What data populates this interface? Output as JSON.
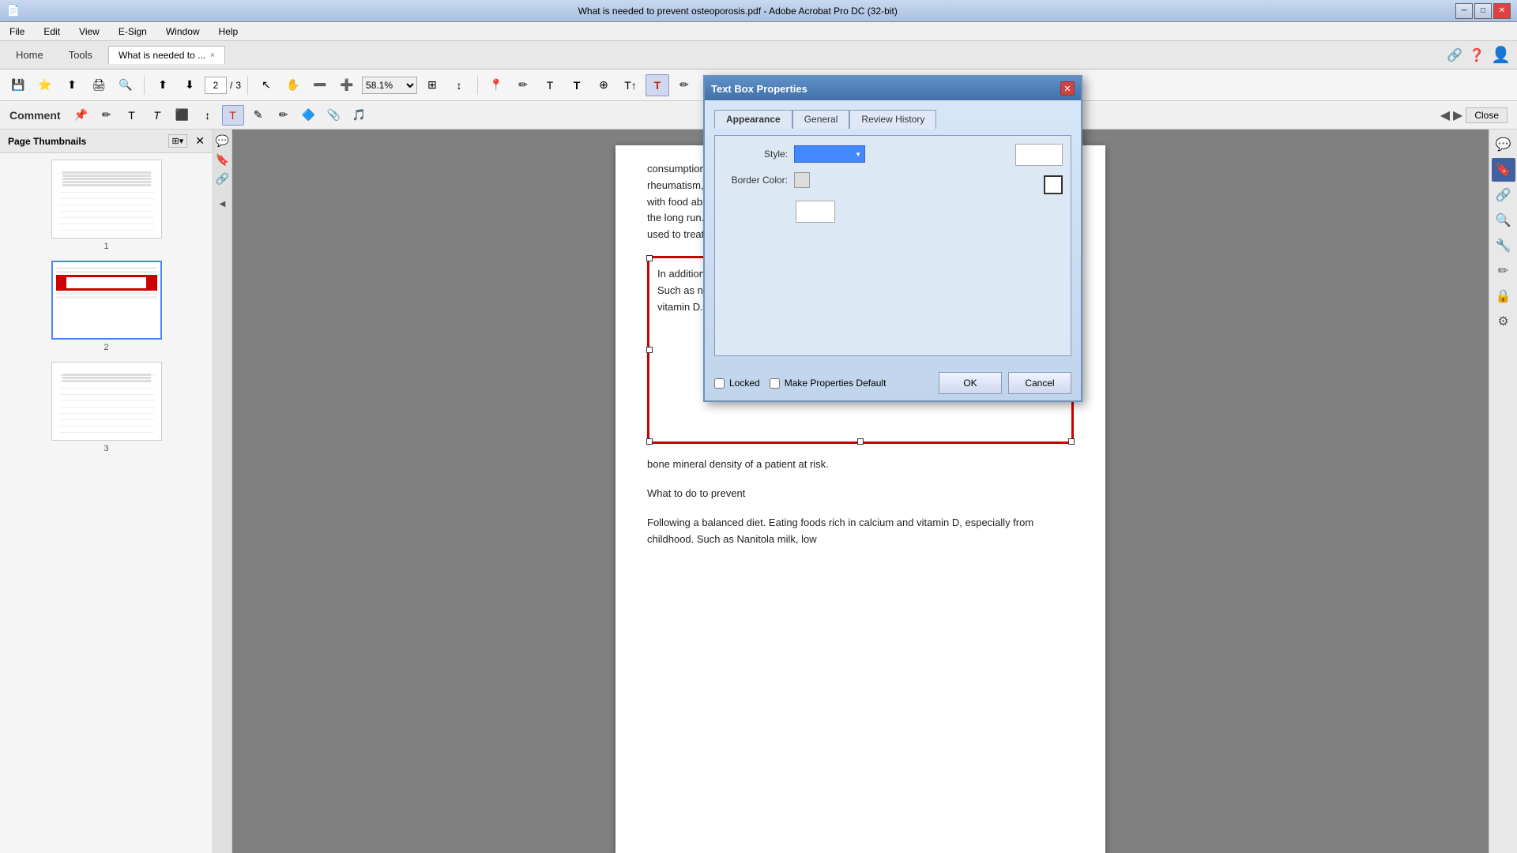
{
  "window": {
    "title": "What is needed to prevent osteoporosis.pdf - Adobe Acrobat Pro DC (32-bit)",
    "close_btn": "✕",
    "min_btn": "─",
    "max_btn": "□"
  },
  "menu": {
    "items": [
      "File",
      "Edit",
      "View",
      "E-Sign",
      "Window",
      "Help"
    ]
  },
  "tabs": {
    "home": "Home",
    "tools": "Tools",
    "document": "What is needed to ...",
    "close": "×"
  },
  "toolbar": {
    "page_current": "2",
    "page_total": "3",
    "page_separator": "/",
    "zoom": "58.1%"
  },
  "comment_toolbar": {
    "label": "Comment"
  },
  "sidebar": {
    "title": "Page Thumbnails",
    "pages": [
      {
        "num": "1"
      },
      {
        "num": "2"
      },
      {
        "num": "3"
      }
    ]
  },
  "document": {
    "para1": "consumption. In addition, some diseases increase the risk of osteoporosis. Such as rheumatism, hypogonadism, thyroid or parathyroid hormone problems; Diseases that interfere with food absorption, such as celiac disease and Crohn's disease. If someone is bedridden in the long run. Some drugs also increase bone loss. Such as steroids, anticonvulsants, drugs used to treat cancer.",
    "text_box": "In addition to aging and menopause, there are other causes and risks of osteoporosis. Such as not doing adequate amount of physical exertion. Not getting enough calcium and vitamin D. Malnutrition and underweight. Excessive smoking or alcohol consumption.",
    "para3": "bone mineral density of a patient at risk.",
    "para4": "What to do to prevent",
    "para5": "Following a balanced diet. Eating foods rich in calcium and vitamin D, especially from childhood. Such as Nanitola milk, low"
  },
  "dialog": {
    "title": "Text Box Properties",
    "close_btn": "✕",
    "tabs": {
      "appearance": "Appearance",
      "general": "General",
      "review_history": "Review History"
    },
    "style_label": "Style:",
    "border_color_label": "Border Color:",
    "locked_label": "Locked",
    "make_default_label": "Make Properties Default",
    "ok_btn": "OK",
    "cancel_btn": "Cancel"
  },
  "right_sidebar": {
    "icons": [
      "💬",
      "🔖",
      "🔗",
      "🔍",
      "📋",
      "✏️",
      "🔒",
      "⚙️"
    ]
  }
}
